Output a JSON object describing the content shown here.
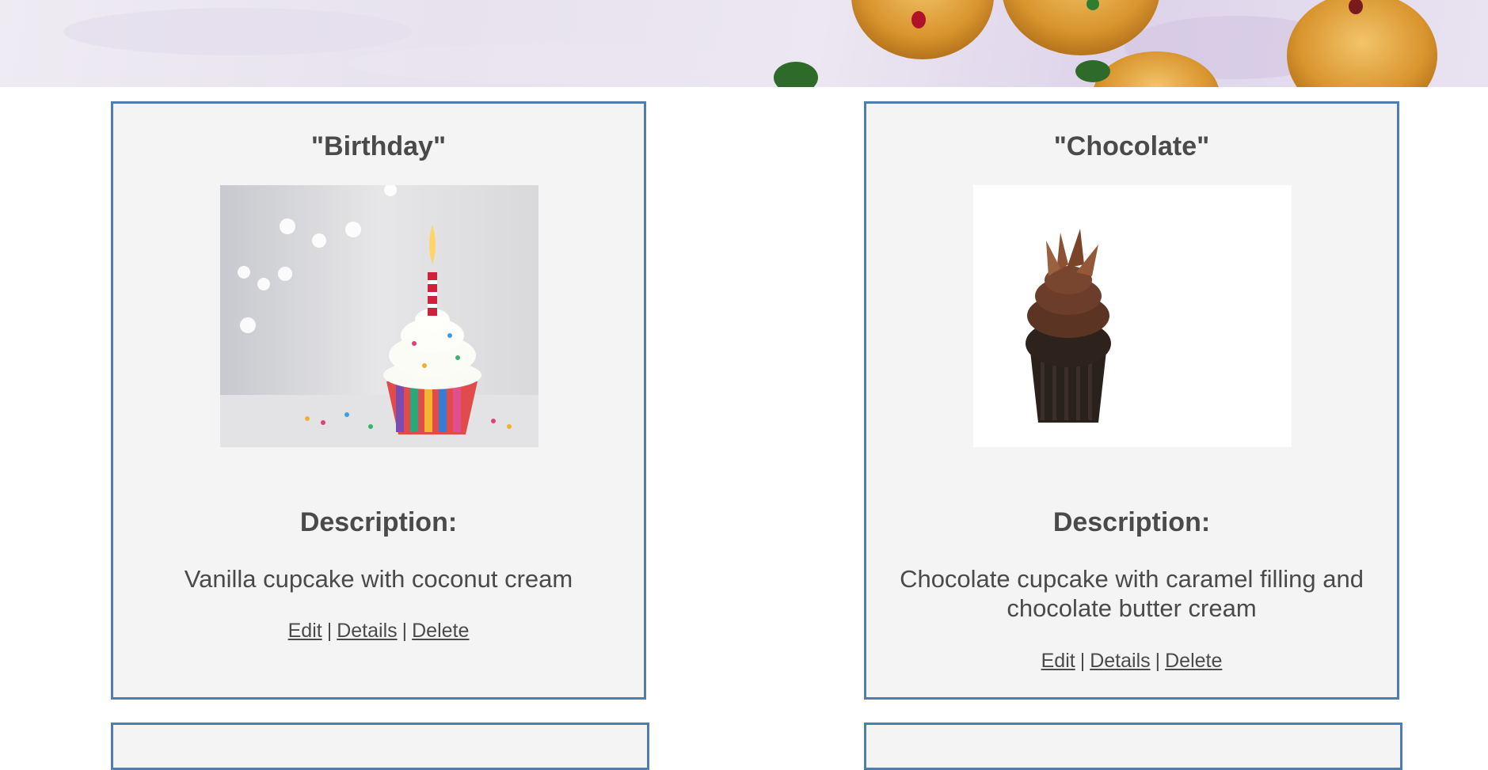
{
  "cards": [
    {
      "title": "\"Birthday\"",
      "image_subject": "birthday cupcake with candle",
      "description_heading": "Description:",
      "description": "Vanilla cupcake with coconut cream",
      "actions": {
        "edit": "Edit",
        "details": "Details",
        "delete": "Delete",
        "separator": "|"
      }
    },
    {
      "title": "\"Chocolate\"",
      "image_subject": "chocolate cupcake",
      "description_heading": "Description:",
      "description": "Chocolate cupcake with caramel filling and chocolate butter cream",
      "actions": {
        "edit": "Edit",
        "details": "Details",
        "delete": "Delete",
        "separator": "|"
      }
    }
  ],
  "colors": {
    "card_border": "#4a7fb0",
    "card_background": "#f4f4f4",
    "text": "#4a4a4a"
  }
}
